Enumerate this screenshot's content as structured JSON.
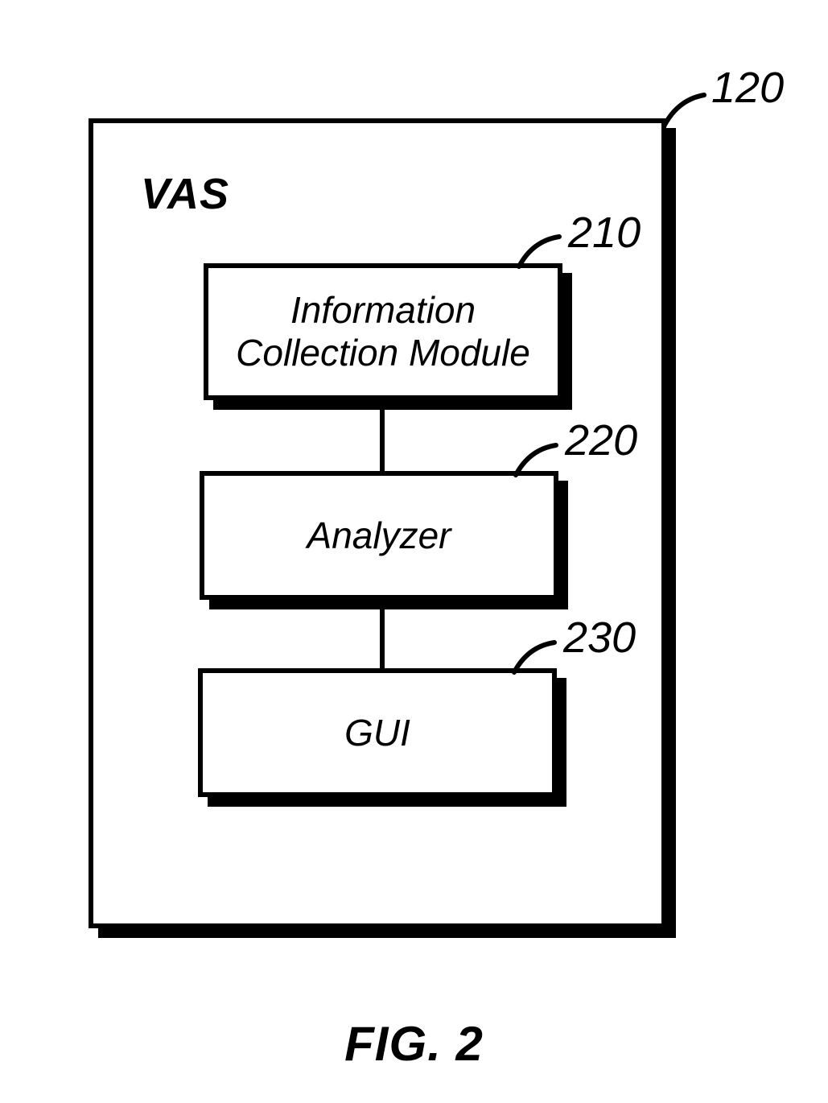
{
  "diagram": {
    "container_label": "VAS",
    "container_ref": "120",
    "blocks": [
      {
        "label": "Information\nCollection Module",
        "ref": "210"
      },
      {
        "label": "Analyzer",
        "ref": "220"
      },
      {
        "label": "GUI",
        "ref": "230"
      }
    ],
    "caption": "FIG. 2"
  }
}
